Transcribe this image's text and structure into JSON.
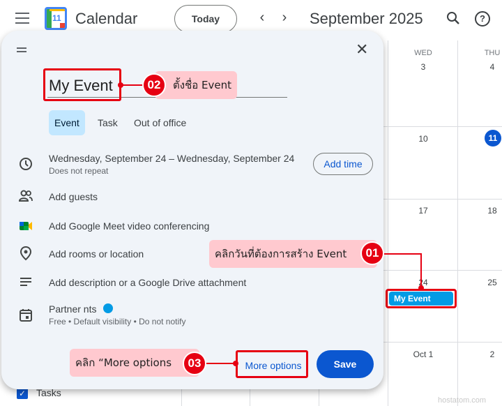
{
  "header": {
    "app_title": "Calendar",
    "logo_day": "11",
    "today_label": "Today",
    "month_title": "September 2025",
    "prev_glyph": "‹",
    "next_glyph": "›",
    "help_glyph": "?"
  },
  "grid": {
    "day_headers": [
      "WED",
      "THU"
    ],
    "day_numbers": [
      "3",
      "4",
      "10",
      "11",
      "17",
      "18",
      "24",
      "25",
      "Oct 1",
      "2"
    ],
    "event_chip": "My Event"
  },
  "sidebar": {
    "tasks_label": "Tasks"
  },
  "dialog": {
    "close_glyph": "✕",
    "title_value": "My Event",
    "tabs": [
      "Event",
      "Task",
      "Out of office"
    ],
    "date_text": "Wednesday, September 24   –   Wednesday, September 24",
    "repeat_text": "Does not repeat",
    "add_time": "Add time",
    "add_guests": "Add guests",
    "meet_text": "Add Google Meet video conferencing",
    "location_text": "Add rooms or location",
    "description_text": "Add description or a Google Drive attachment",
    "calendar_name": "Partner nts",
    "calendar_sub": "Free • Default visibility • Do not notify",
    "more_options": "More options",
    "save": "Save"
  },
  "annotations": {
    "step1_label": "คลิกวันที่ต้องการสร้าง Event",
    "step1_badge": "01",
    "step2_label": "ตั้งชื่อ Event",
    "step2_badge": "02",
    "step3_label": "คลิก “More options",
    "step3_badge": "03"
  },
  "watermark": "hostatom.com",
  "colors": {
    "accent": "#0b57d0",
    "event": "#039be5",
    "annotation": "#e60012",
    "annotation_bg": "#ffc9cf"
  },
  "icons": [
    "hamburger-icon",
    "search-icon",
    "help-icon",
    "close-icon",
    "clock-icon",
    "guests-icon",
    "meet-icon",
    "location-icon",
    "description-icon",
    "calendar-icon"
  ]
}
